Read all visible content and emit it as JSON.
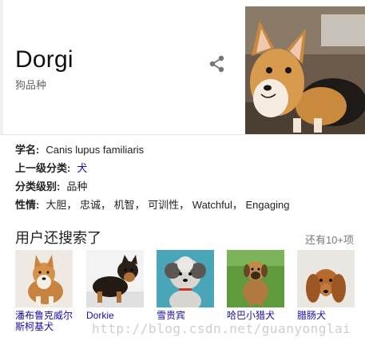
{
  "header": {
    "title": "Dorgi",
    "subtitle": "狗品种",
    "share_icon": "share-icon"
  },
  "facts": [
    {
      "label": "学名:",
      "value": "Canis lupus familiaris",
      "link": false
    },
    {
      "label": "上一级分类:",
      "value": "犬",
      "link": true
    },
    {
      "label": "分类级别:",
      "value": "品种",
      "link": false
    },
    {
      "label": "性情:",
      "value": "大胆， 忠诚， 机智， 可训性， Watchful， Engaging",
      "link": false
    }
  ],
  "related": {
    "title": "用户还搜索了",
    "more": "还有10+项",
    "items": [
      {
        "label": "潘布鲁克威尔斯柯基犬"
      },
      {
        "label": "Dorkie"
      },
      {
        "label": "雪贵宾"
      },
      {
        "label": "哈巴小猎犬"
      },
      {
        "label": "腊肠犬"
      }
    ]
  },
  "watermark": "http://blog.csdn.net/guanyonglai",
  "colors": {
    "link": "#1a0dab",
    "divider": "#e6e6e6",
    "muted": "#777777"
  }
}
